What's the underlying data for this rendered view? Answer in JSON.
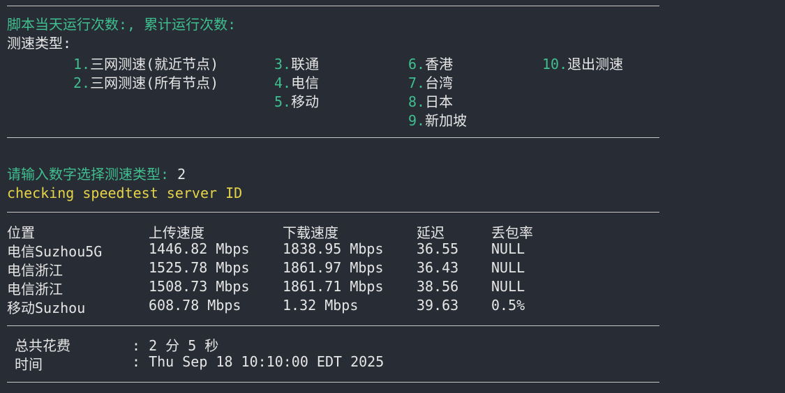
{
  "terminal": {
    "run_counts_label": "脚本当天运行次数:, 累计运行次数:",
    "type_label": "测速类型:",
    "menu": [
      {
        "num": "1.",
        "label": "三网测速(就近节点)"
      },
      {
        "num": "2.",
        "label": "三网测速(所有节点)"
      },
      {
        "num": "3.",
        "label": "联通"
      },
      {
        "num": "4.",
        "label": "电信"
      },
      {
        "num": "5.",
        "label": "移动"
      },
      {
        "num": "6.",
        "label": "香港"
      },
      {
        "num": "7.",
        "label": "台湾"
      },
      {
        "num": "8.",
        "label": "日本"
      },
      {
        "num": "9.",
        "label": "新加坡"
      },
      {
        "num": "10.",
        "label": "退出测速"
      }
    ],
    "prompt_label": "请输入数字选择测速类型:",
    "prompt_value": " 2",
    "checking_line": "checking speedtest server ID",
    "table": {
      "headers": [
        "位置",
        "上传速度",
        "下载速度",
        "延迟",
        "丢包率"
      ],
      "rows": [
        [
          "电信Suzhou5G",
          "1446.82 Mbps",
          "1838.95 Mbps",
          "36.55",
          "NULL"
        ],
        [
          "电信浙江",
          "1525.78 Mbps",
          "1861.97 Mbps",
          "36.43",
          "NULL"
        ],
        [
          "电信浙江",
          "1508.73 Mbps",
          "1861.71 Mbps",
          "38.56",
          "NULL"
        ],
        [
          "移动Suzhou",
          "608.78 Mbps",
          "1.32 Mbps",
          "39.63",
          "0.5%"
        ]
      ]
    },
    "summary": {
      "total_label": "总共花费",
      "total_value": ": 2 分 5 秒",
      "time_label": "时间",
      "time_value": ": Thu Sep 18 10:10:00 EDT 2025"
    }
  },
  "colors": {
    "background": "#282c34",
    "accent_green": "#3fbf8f",
    "accent_yellow": "#e5d44a",
    "text": "#e6e6e6"
  }
}
